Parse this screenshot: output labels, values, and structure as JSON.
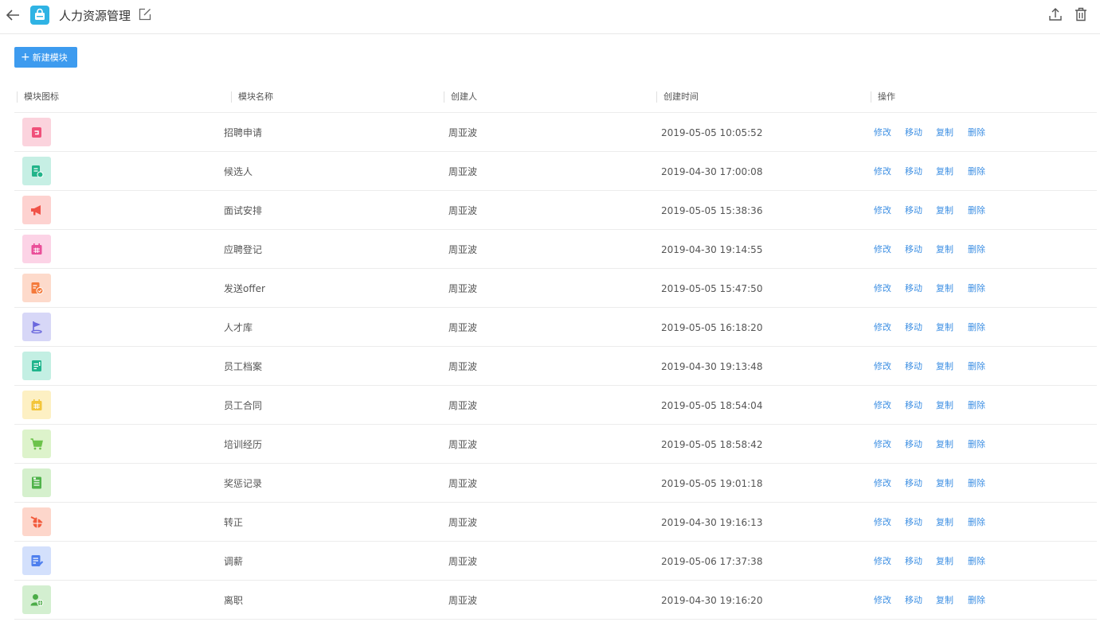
{
  "header": {
    "title": "人力资源管理",
    "icons": {
      "back": "arrow-left-icon",
      "app": "bag-icon",
      "edit": "edit-icon",
      "export": "upload-icon",
      "delete": "trash-icon"
    }
  },
  "toolbar": {
    "new_module_label": "新建模块",
    "plus": "+"
  },
  "table": {
    "columns": [
      "模块图标",
      "模块名称",
      "创建人",
      "创建时间",
      "操作"
    ],
    "actions": [
      "修改",
      "移动",
      "复制",
      "删除"
    ],
    "rows": [
      {
        "icon": "clipboard-icon",
        "icon_bg": "#fbd3dd",
        "icon_color": "#f0507a",
        "name": "招聘申请",
        "creator": "周亚波",
        "time": "2019-05-05 10:05:52"
      },
      {
        "icon": "doc-clock-icon",
        "icon_bg": "#c6efe4",
        "icon_color": "#22b48a",
        "name": "候选人",
        "creator": "周亚波",
        "time": "2019-04-30 17:00:08"
      },
      {
        "icon": "megaphone-icon",
        "icon_bg": "#fdd2d0",
        "icon_color": "#f05248",
        "name": "面试安排",
        "creator": "周亚波",
        "time": "2019-05-05 15:38:36"
      },
      {
        "icon": "calendar-icon",
        "icon_bg": "#fcd3e6",
        "icon_color": "#ea4f99",
        "name": "应聘登记",
        "creator": "周亚波",
        "time": "2019-04-30 19:14:55"
      },
      {
        "icon": "doc-check-icon",
        "icon_bg": "#fddacb",
        "icon_color": "#f47a3c",
        "name": "发送offer",
        "creator": "周亚波",
        "time": "2019-05-05 15:47:50"
      },
      {
        "icon": "flag-icon",
        "icon_bg": "#d7d7f7",
        "icon_color": "#6a67dd",
        "name": "人才库",
        "creator": "周亚波",
        "time": "2019-05-05 16:18:20"
      },
      {
        "icon": "document-icon",
        "icon_bg": "#c3efe3",
        "icon_color": "#1fb48c",
        "name": "员工档案",
        "creator": "周亚波",
        "time": "2019-04-30 19:13:48"
      },
      {
        "icon": "calendar-icon",
        "icon_bg": "#fdf0c3",
        "icon_color": "#f3c53a",
        "name": "员工合同",
        "creator": "周亚波",
        "time": "2019-05-05 18:54:04"
      },
      {
        "icon": "cart-icon",
        "icon_bg": "#ddf3cb",
        "icon_color": "#6cc34a",
        "name": "培训经历",
        "creator": "周亚波",
        "time": "2019-05-05 18:58:42"
      },
      {
        "icon": "sheet-icon",
        "icon_bg": "#d5f0cd",
        "icon_color": "#4fb34a",
        "name": "奖惩记录",
        "creator": "周亚波",
        "time": "2019-05-05 19:01:18"
      },
      {
        "icon": "plane-globe-icon",
        "icon_bg": "#fdd6cb",
        "icon_color": "#f25a3b",
        "name": "转正",
        "creator": "周亚波",
        "time": "2019-04-30 19:16:13"
      },
      {
        "icon": "doc-pen-icon",
        "icon_bg": "#d3e0fc",
        "icon_color": "#4e7fee",
        "name": "调薪",
        "creator": "周亚波",
        "time": "2019-05-06 17:37:38"
      },
      {
        "icon": "user-globe-icon",
        "icon_bg": "#d3efd0",
        "icon_color": "#4cac48",
        "name": "离职",
        "creator": "周亚波",
        "time": "2019-04-30 19:16:20"
      }
    ]
  }
}
